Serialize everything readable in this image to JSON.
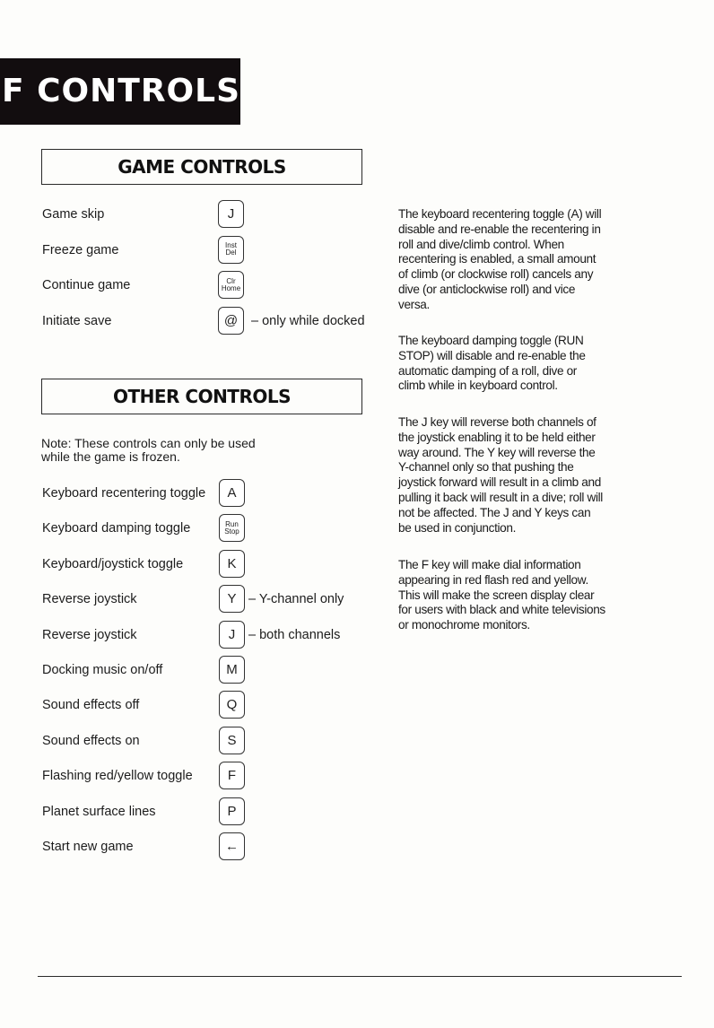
{
  "banner": {
    "title": "F CONTROLS"
  },
  "game_controls": {
    "heading": "GAME CONTROLS",
    "items": [
      {
        "label": "Game skip",
        "key": [
          "J"
        ],
        "note": ""
      },
      {
        "label": "Freeze game",
        "key": [
          "Inst",
          "Del"
        ],
        "note": ""
      },
      {
        "label": "Continue game",
        "key": [
          "Clr",
          "Home"
        ],
        "note": ""
      },
      {
        "label": "Initiate save",
        "key": [
          "@"
        ],
        "note": "– only while docked"
      }
    ]
  },
  "other_controls": {
    "heading": "OTHER CONTROLS",
    "note": "Note: These controls can only be used while the game is frozen.",
    "items": [
      {
        "label": "Keyboard recentering toggle",
        "key": [
          "A"
        ],
        "note": ""
      },
      {
        "label": "Keyboard damping toggle",
        "key": [
          "Run",
          "Stop"
        ],
        "note": ""
      },
      {
        "label": "Keyboard/joystick toggle",
        "key": [
          "K"
        ],
        "note": ""
      },
      {
        "label": "Reverse joystick",
        "key": [
          "Y"
        ],
        "note": "– Y-channel only"
      },
      {
        "label": "Reverse joystick",
        "key": [
          "J"
        ],
        "note": "– both channels"
      },
      {
        "label": "Docking music on/off",
        "key": [
          "M"
        ],
        "note": ""
      },
      {
        "label": "Sound effects off",
        "key": [
          "Q"
        ],
        "note": ""
      },
      {
        "label": "Sound effects on",
        "key": [
          "S"
        ],
        "note": ""
      },
      {
        "label": "Flashing red/yellow toggle",
        "key": [
          "F"
        ],
        "note": ""
      },
      {
        "label": "Planet surface lines",
        "key": [
          "P"
        ],
        "note": ""
      },
      {
        "label": "Start new game",
        "key": [
          "←"
        ],
        "note": ""
      }
    ]
  },
  "explanations": [
    "The keyboard recentering toggle (A) will disable and re-enable the recentering in roll and dive/climb control. When recentering is enabled, a small amount of climb (or clockwise roll) cancels any dive (or anticlockwise roll) and vice versa.",
    "The keyboard damping toggle (RUN STOP) will disable and re-enable the automatic damping of a roll, dive or climb while in keyboard control.",
    "The J key will reverse both channels of the joystick enabling it to be held either way around. The Y key will reverse the Y-channel only so that pushing the joystick forward will result in a climb and pulling it back will result in a dive; roll will not be affected. The J and Y keys can be used in conjunction.",
    "The F key will make dial information appearing in red flash red and yellow. This will make the screen display clear for users with black and white televisions or monochrome monitors."
  ]
}
